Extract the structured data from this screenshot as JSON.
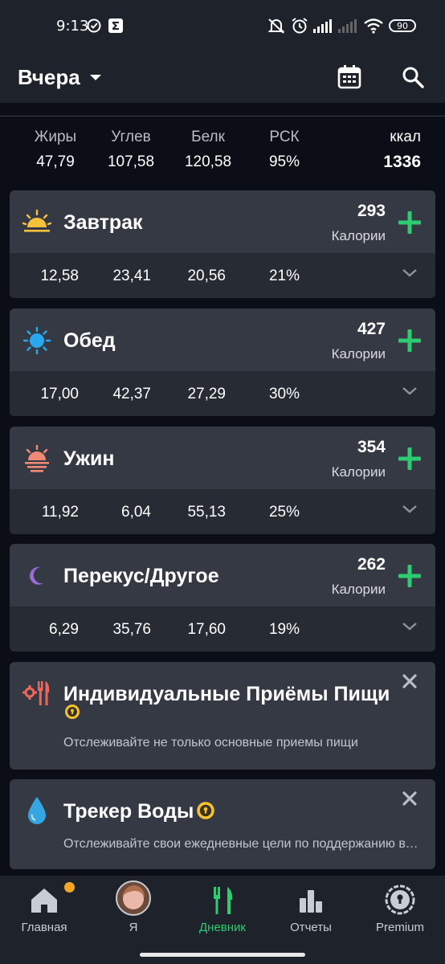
{
  "status_bar": {
    "time": "9:13",
    "battery": "90"
  },
  "header": {
    "date_label": "Вчера"
  },
  "summary": {
    "labels": [
      "Жиры",
      "Углев",
      "Белк",
      "РСК",
      "ккал"
    ],
    "values": [
      "47,79",
      "107,58",
      "120,58",
      "95%",
      "1336"
    ]
  },
  "meals": [
    {
      "name": "Завтрак",
      "calories": "293",
      "cal_label": "Калории",
      "fat": "12,58",
      "carbs": "23,41",
      "protein": "20,56",
      "rdi": "21%"
    },
    {
      "name": "Обед",
      "calories": "427",
      "cal_label": "Калории",
      "fat": "17,00",
      "carbs": "42,37",
      "protein": "27,29",
      "rdi": "30%"
    },
    {
      "name": "Ужин",
      "calories": "354",
      "cal_label": "Калории",
      "fat": "11,92",
      "carbs": "6,04",
      "protein": "55,13",
      "rdi": "25%"
    },
    {
      "name": "Перекус/Другое",
      "calories": "262",
      "cal_label": "Калории",
      "fat": "6,29",
      "carbs": "35,76",
      "protein": "17,60",
      "rdi": "19%"
    }
  ],
  "promos": [
    {
      "title": "Индивидуальные Приёмы Пищи",
      "desc": "Отслеживайте не только основные приемы пищи"
    },
    {
      "title": "Трекер Воды",
      "desc": "Отслеживайте свои ежедневные цели по поддержанию водного баланса"
    }
  ],
  "nav": {
    "items": [
      "Главная",
      "Я",
      "Дневник",
      "Отчеты",
      "Premium"
    ],
    "active": "Дневник"
  },
  "colors": {
    "accent": "#2ecc71",
    "background": "#0b0e16",
    "card": "#353944",
    "card_bottom": "#272b33",
    "notification": "#f5a623"
  }
}
